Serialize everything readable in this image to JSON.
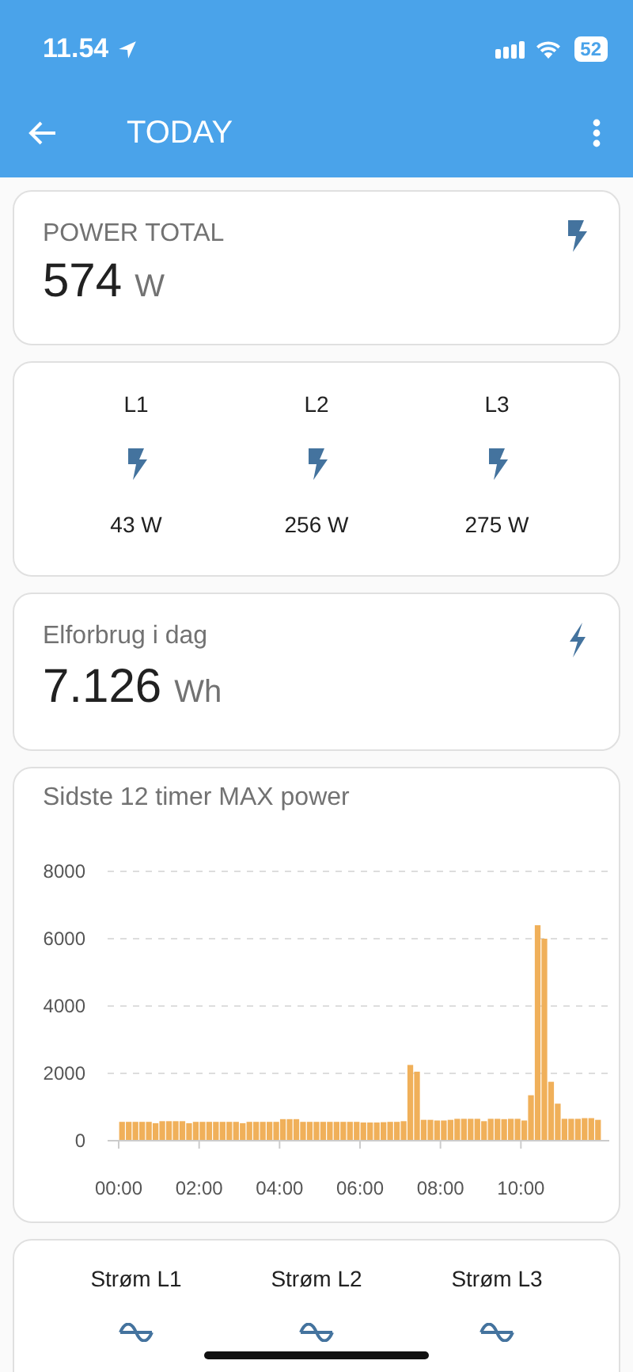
{
  "status_bar": {
    "time": "11.54",
    "battery": "52"
  },
  "app_bar": {
    "title": "TODAY"
  },
  "power_total": {
    "title": "POWER TOTAL",
    "value": "574",
    "unit": "W"
  },
  "phases": [
    {
      "label": "L1",
      "value": "43 W"
    },
    {
      "label": "L2",
      "value": "256 W"
    },
    {
      "label": "L3",
      "value": "275 W"
    }
  ],
  "energy_today": {
    "title": "Elforbrug i dag",
    "value": "7.126",
    "unit": "Wh"
  },
  "max_power": {
    "title": "Sidste 12 timer MAX power",
    "chart_data": {
      "type": "bar",
      "grid": true,
      "xlim": [
        0,
        720
      ],
      "x": [
        0,
        10,
        20,
        30,
        40,
        50,
        60,
        70,
        80,
        90,
        100,
        110,
        120,
        130,
        140,
        150,
        160,
        170,
        180,
        190,
        200,
        210,
        220,
        230,
        240,
        250,
        260,
        270,
        280,
        290,
        300,
        310,
        320,
        330,
        340,
        350,
        360,
        370,
        380,
        390,
        400,
        410,
        420,
        430,
        440,
        450,
        460,
        470,
        480,
        490,
        500,
        510,
        520,
        530,
        540,
        550,
        560,
        570,
        580,
        590,
        600,
        610,
        620,
        630,
        640,
        650,
        660,
        670,
        680,
        690,
        700,
        710
      ],
      "ylim": [
        0,
        8000
      ],
      "yticks": [
        0,
        2000,
        4000,
        6000,
        8000
      ],
      "xticks": [
        {
          "value": 0,
          "label": "00:00"
        },
        {
          "value": 120,
          "label": "02:00"
        },
        {
          "value": 240,
          "label": "04:00"
        },
        {
          "value": 360,
          "label": "06:00"
        },
        {
          "value": 480,
          "label": "08:00"
        },
        {
          "value": 600,
          "label": "10:00"
        }
      ],
      "series": [
        {
          "color": "#f0b05a",
          "values": [
            560,
            560,
            560,
            560,
            560,
            520,
            580,
            580,
            580,
            580,
            520,
            560,
            560,
            560,
            560,
            560,
            560,
            560,
            520,
            560,
            560,
            560,
            560,
            560,
            640,
            640,
            640,
            560,
            560,
            560,
            560,
            560,
            560,
            560,
            560,
            560,
            540,
            540,
            540,
            550,
            560,
            560,
            580,
            2250,
            2050,
            620,
            620,
            600,
            600,
            620,
            650,
            650,
            650,
            650,
            580,
            650,
            650,
            640,
            650,
            650,
            600,
            1350,
            6400,
            6000,
            1750,
            1100,
            650,
            650,
            650,
            670,
            670,
            620
          ]
        }
      ]
    }
  },
  "currents": [
    {
      "label": "Strøm L1"
    },
    {
      "label": "Strøm L2"
    },
    {
      "label": "Strøm L3"
    }
  ]
}
